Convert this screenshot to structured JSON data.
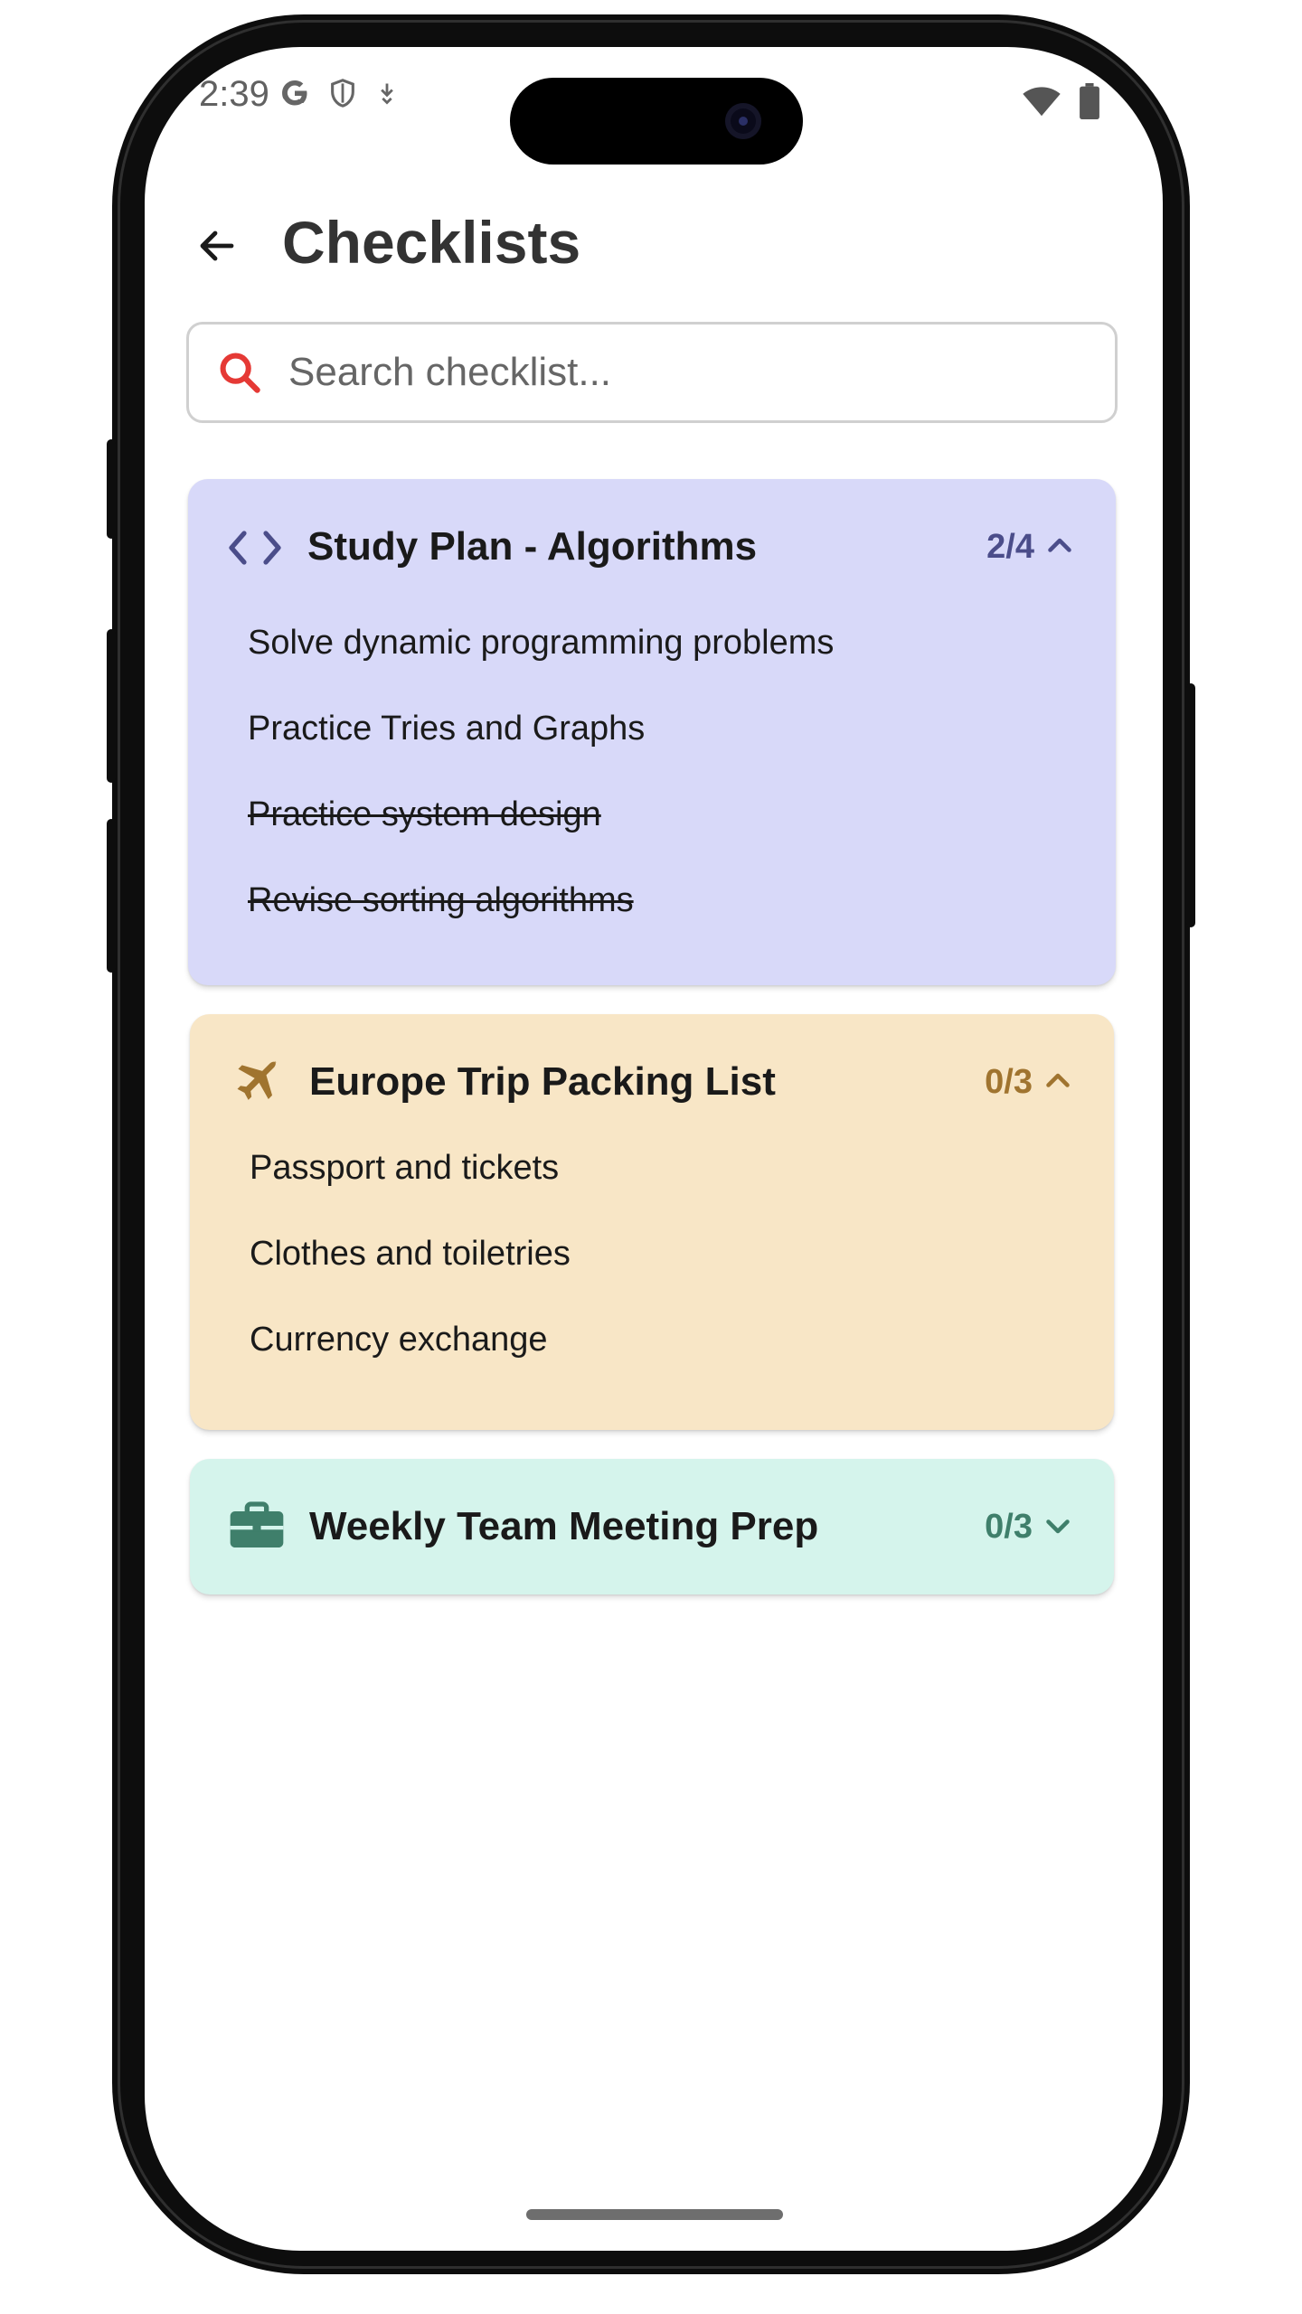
{
  "status_bar": {
    "time": "2:39",
    "left_icons": [
      "google-icon",
      "shield-icon",
      "download-icon"
    ],
    "right_icons": [
      "wifi-icon",
      "battery-icon"
    ]
  },
  "header": {
    "title": "Checklists",
    "back_icon": "arrow-left-icon"
  },
  "search": {
    "placeholder": "Search checklist...",
    "value": "",
    "icon": "search-icon",
    "icon_color": "#e53935"
  },
  "checklists": [
    {
      "title": "Study Plan - Algorithms",
      "icon": "code-icon",
      "count": "2/4",
      "expanded": true,
      "background": "#d8d9f9",
      "accent": "#4b4d8a",
      "items": [
        {
          "label": "Solve dynamic programming problems",
          "done": false
        },
        {
          "label": "Practice Tries and Graphs",
          "done": false
        },
        {
          "label": "Practice system design",
          "done": true
        },
        {
          "label": "Revise sorting algorithms",
          "done": true
        }
      ]
    },
    {
      "title": "Europe Trip Packing List",
      "icon": "airplane-icon",
      "count": "0/3",
      "expanded": true,
      "background": "#f8e6c6",
      "accent": "#a0742f",
      "items": [
        {
          "label": "Passport and tickets",
          "done": false
        },
        {
          "label": "Clothes and toiletries",
          "done": false
        },
        {
          "label": "Currency exchange",
          "done": false
        }
      ]
    },
    {
      "title": "Weekly Team Meeting Prep",
      "icon": "briefcase-icon",
      "count": "0/3",
      "expanded": false,
      "background": "#d5f4ec",
      "accent": "#3f7f6b",
      "items": []
    }
  ]
}
